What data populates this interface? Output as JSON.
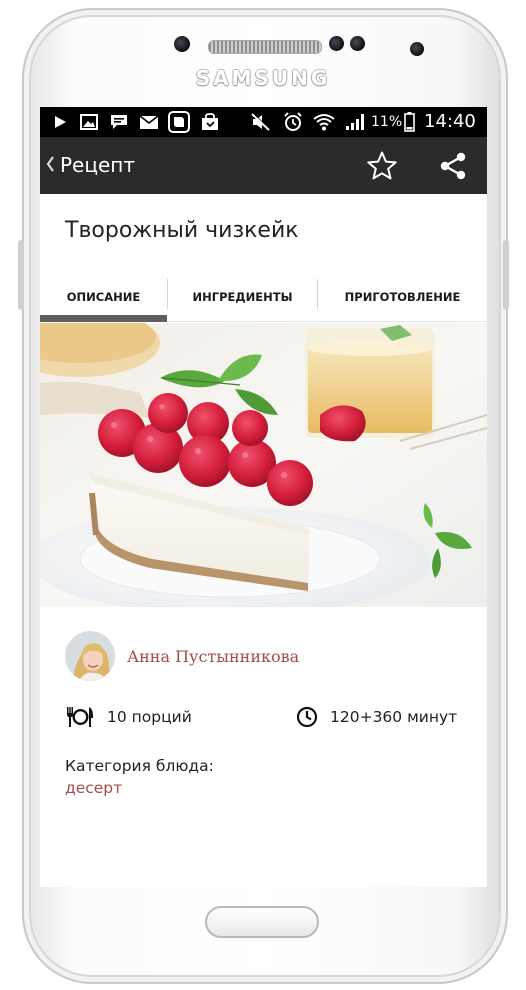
{
  "device": {
    "brand": "SAMSUNG"
  },
  "status_bar": {
    "battery_percent": "11%",
    "time": "14:40"
  },
  "app_bar": {
    "title": "Рецепт"
  },
  "recipe": {
    "title": "Творожный чизкейк",
    "tabs": [
      {
        "label": "ОПИСАНИЕ",
        "active": true
      },
      {
        "label": "ИНГРЕДИЕНТЫ",
        "active": false
      },
      {
        "label": "ПРИГОТОВЛЕНИЕ",
        "active": false
      }
    ],
    "author": {
      "name": "Анна Пустынникова"
    },
    "servings": "10 порций",
    "time": "120+360 минут",
    "category_label": "Категория блюда:",
    "category_value": "десерт"
  },
  "colors": {
    "accent": "#a74a4a",
    "app_bar": "#2b2b2b",
    "tab_indicator": "#5e5e5e"
  }
}
